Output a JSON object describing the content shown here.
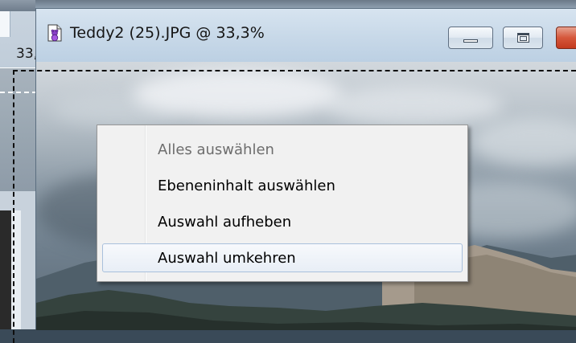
{
  "background_window": {
    "zoom_fragment": "33,"
  },
  "document_window": {
    "title": "Teddy2 (25).JPG @ 33,3%",
    "controls": {
      "minimize_icon": "minimize-icon",
      "maximize_icon": "maximize-icon",
      "close_icon": "close-icon",
      "close_color": "#d04a2c"
    }
  },
  "context_menu": {
    "items": [
      {
        "label": "Alles auswählen",
        "state": "disabled"
      },
      {
        "label": "Ebeneninhalt auswählen",
        "state": "enabled"
      },
      {
        "label": "Auswahl aufheben",
        "state": "enabled"
      },
      {
        "label": "Auswahl umkehren",
        "state": "hovered"
      }
    ]
  }
}
